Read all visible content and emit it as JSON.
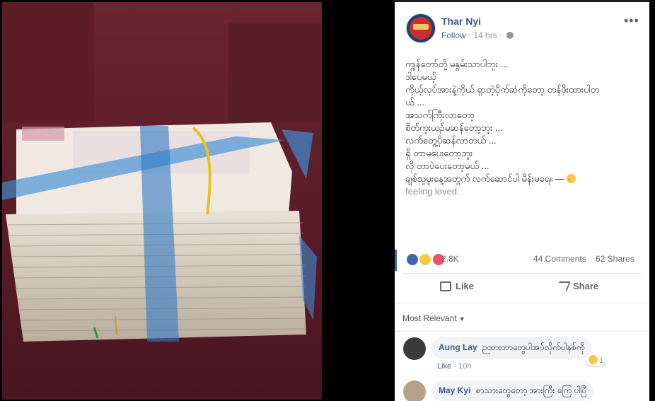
{
  "post": {
    "author": "Thar Nyi",
    "follow": "Follow",
    "time": "14 hrs",
    "more_icon": "more-horizontal-icon",
    "text_lines": [
      "ကျွန်တော်တို့ မနွမ်းသာပါဘူး ...",
      "ဒါပေမယ့်",
      "ကိုယ့်လုပ်အားနဲ့ကိုယ် ရှာတဲ့ပိုက်ဆံကိုတော့ တန်ဖိုးထားပါတ",
      "ယ် ...",
      "အသက်ကြီးလာတော့",
      "စိတ်ကူးယဉ်မဆန်တော့ဘူး ...",
      "လက်တွေ့ပိုဆန်လာတယ် ...",
      "ရှိ တာမပေးတော့ဘူး",
      "လို တာပဲပေးတော့မယ် ...",
      "ချစ်သူမှုးနေ့အတွက် လက်ဆောင်ပါ မိန်းမရေ။ —"
    ],
    "feeling": "feeling loved."
  },
  "stats": {
    "reactions_count": "2.8K",
    "comments": "44 Comments",
    "shares": "62 Shares"
  },
  "actions": {
    "like": "Like",
    "share": "Share"
  },
  "comments_filter": "Most Relevant",
  "comments": [
    {
      "name": "Aung Lay",
      "text": "ဉထားတာတွေပါအပ်လိုက်ပါနစ်ကို",
      "like": "Like",
      "time": "10h",
      "reaction_count": "1"
    },
    {
      "name": "May Kyi",
      "text": "စာသားတွေတော့ အားကြီး ကြေ ပါပြီ"
    }
  ],
  "colors": {
    "link_blue": "#365899",
    "like_blue": "#4267b2",
    "text": "#1d2129",
    "muted": "#90949c"
  }
}
